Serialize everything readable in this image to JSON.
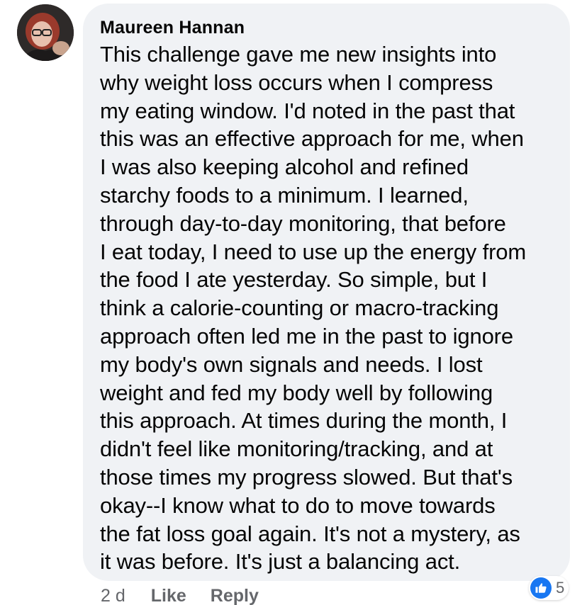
{
  "comment": {
    "author": "Maureen Hannan",
    "text": "This challenge gave me new insights into\nwhy weight loss occurs when I compress\nmy eating window. I'd noted in the past that\nthis was an effective approach for me, when\nI was also keeping alcohol and refined\nstarchy foods to a minimum. I learned,\nthrough day-to-day monitoring, that before\nI eat today, I need to use up the energy from\nthe food I ate yesterday. So simple, but I\nthink a calorie-counting or macro-tracking\napproach often led me in the past to ignore\nmy body's own signals and needs. I lost\nweight and fed my body well by following\nthis approach. At times during the month, I\ndidn't feel like monitoring/tracking, and at\nthose times my progress slowed. But that's\nokay--I know what to do to move towards\nthe fat loss goal again. It's not a mystery, as\nit was before. It's just a balancing act.",
    "timestamp": "2 d",
    "like_label": "Like",
    "reply_label": "Reply",
    "reaction_count": "5",
    "reaction_icon": "thumbs-up-icon"
  },
  "colors": {
    "bubble_background": "#f0f2f5",
    "text": "#050505",
    "secondary_text": "#65676b",
    "like_blue": "#1877f2"
  }
}
